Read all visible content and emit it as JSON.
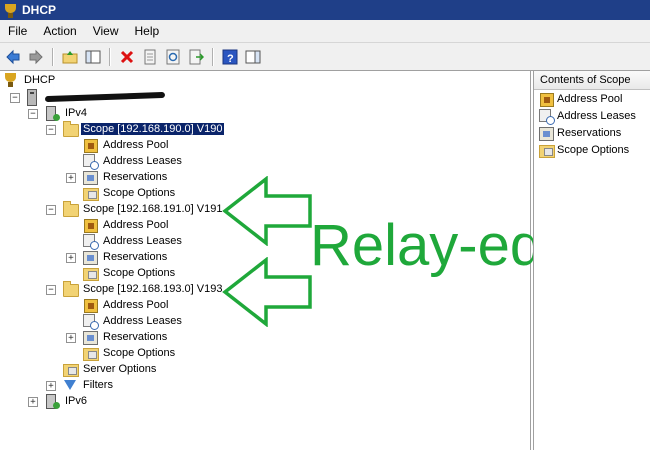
{
  "window": {
    "title": "DHCP"
  },
  "menu": {
    "items": [
      "File",
      "Action",
      "View",
      "Help"
    ]
  },
  "tree": {
    "root": "DHCP",
    "server_name": "",
    "ipv4": "IPv4",
    "scopes": [
      {
        "label": "Scope [192.168.190.0] V190",
        "selected": true,
        "children": [
          "Address Pool",
          "Address Leases",
          "Reservations",
          "Scope Options"
        ]
      },
      {
        "label": "Scope [192.168.191.0] V191",
        "selected": false,
        "children": [
          "Address Pool",
          "Address Leases",
          "Reservations",
          "Scope Options"
        ]
      },
      {
        "label": "Scope [192.168.193.0] V193",
        "selected": false,
        "children": [
          "Address Pool",
          "Address Leases",
          "Reservations",
          "Scope Options"
        ]
      }
    ],
    "server_options": "Server Options",
    "filters": "Filters",
    "ipv6": "IPv6"
  },
  "contents_pane": {
    "header": "Contents of Scope",
    "items": [
      "Address Pool",
      "Address Leases",
      "Reservations",
      "Scope Options"
    ]
  },
  "annotation": {
    "text": "Relay-ed",
    "color": "#1fa83a"
  }
}
